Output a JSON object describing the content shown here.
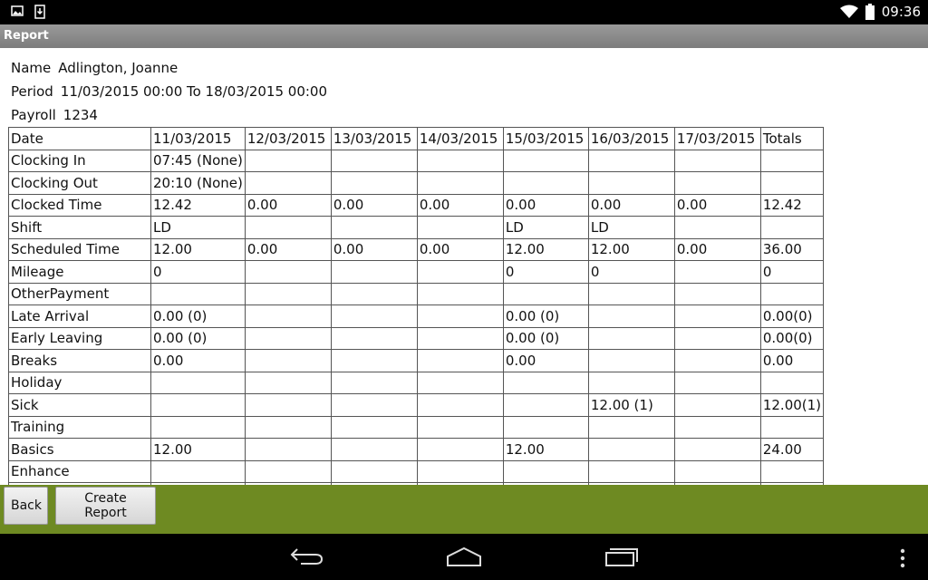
{
  "status_bar": {
    "time": "09:36"
  },
  "title": "Report",
  "info": {
    "name_label": "Name",
    "name_value": "Adlington, Joanne",
    "period_label": "Period",
    "period_value": "11/03/2015 00:00 To 18/03/2015 00:00",
    "payroll_label": "Payroll",
    "payroll_value": "1234"
  },
  "table": {
    "rows": [
      [
        "Date",
        "11/03/2015",
        "12/03/2015",
        "13/03/2015",
        "14/03/2015",
        "15/03/2015",
        "16/03/2015",
        "17/03/2015",
        "Totals"
      ],
      [
        "Clocking In",
        "07:45 (None)",
        "",
        "",
        "",
        "",
        "",
        "",
        ""
      ],
      [
        "Clocking Out",
        "20:10 (None)",
        "",
        "",
        "",
        "",
        "",
        "",
        ""
      ],
      [
        "Clocked Time",
        "12.42",
        "0.00",
        "0.00",
        "0.00",
        "0.00",
        "0.00",
        "0.00",
        "12.42"
      ],
      [
        "Shift",
        "LD",
        "",
        "",
        "",
        "LD",
        "LD",
        "",
        ""
      ],
      [
        "Scheduled Time",
        "12.00",
        "0.00",
        "0.00",
        "0.00",
        "12.00",
        "12.00",
        "0.00",
        "36.00"
      ],
      [
        "Mileage",
        "0",
        "",
        "",
        "",
        "0",
        "0",
        "",
        "0"
      ],
      [
        "OtherPayment",
        "",
        "",
        "",
        "",
        "",
        "",
        "",
        ""
      ],
      [
        "Late Arrival",
        "0.00 (0)",
        "",
        "",
        "",
        "0.00 (0)",
        "",
        "",
        "0.00(0)"
      ],
      [
        "Early Leaving",
        "0.00 (0)",
        "",
        "",
        "",
        "0.00 (0)",
        "",
        "",
        "0.00(0)"
      ],
      [
        "Breaks",
        "0.00",
        "",
        "",
        "",
        "0.00",
        "",
        "",
        "0.00"
      ],
      [
        "Holiday",
        "",
        "",
        "",
        "",
        "",
        "",
        "",
        ""
      ],
      [
        "Sick",
        "",
        "",
        "",
        "",
        "",
        "12.00 (1)",
        "",
        "12.00(1)"
      ],
      [
        "Training",
        "",
        "",
        "",
        "",
        "",
        "",
        "",
        ""
      ],
      [
        "Basics",
        "12.00",
        "",
        "",
        "",
        "12.00",
        "",
        "",
        "24.00"
      ],
      [
        "Enhance",
        "",
        "",
        "",
        "",
        "",
        "",
        "",
        ""
      ],
      [
        "",
        "",
        "",
        "",
        "",
        "",
        "",
        "",
        ""
      ]
    ]
  },
  "buttons": {
    "back": "Back",
    "create_report": "Create Report"
  },
  "colors": {
    "button_bar": "#6e8a22",
    "title_bar": "#8a8a8a"
  }
}
